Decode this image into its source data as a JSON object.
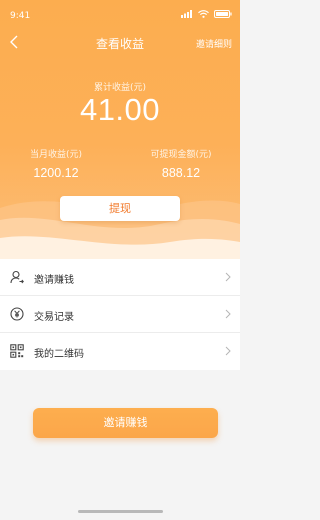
{
  "status_bar": {
    "time": "9:41"
  },
  "nav": {
    "title": "查看收益",
    "rules_label": "邀请细则"
  },
  "earnings": {
    "total_label": "累计收益(元)",
    "total_value": "41.00",
    "month_label": "当月收益(元)",
    "month_value": "1200.12",
    "withdrawable_label": "可提现金额(元)",
    "withdrawable_value": "888.12"
  },
  "withdraw_button": {
    "label": "提现"
  },
  "menu": {
    "items": [
      {
        "label": "邀请赚钱",
        "icon": "invite-user-icon"
      },
      {
        "label": "交易记录",
        "icon": "yuan-coin-icon"
      },
      {
        "label": "我的二维码",
        "icon": "qr-code-icon"
      }
    ]
  },
  "invite_button": {
    "label": "邀请赚钱"
  },
  "colors": {
    "accent": "#fcad4f",
    "withdraw_text": "#f27a2b"
  }
}
